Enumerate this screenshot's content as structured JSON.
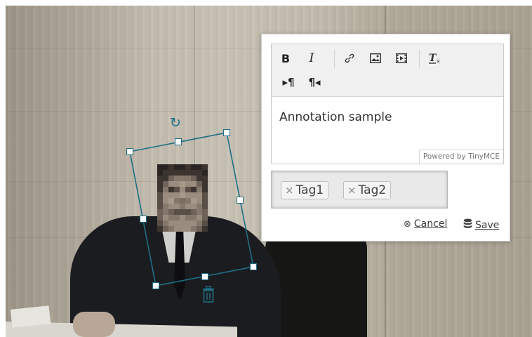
{
  "editor": {
    "toolbar": {
      "bold_label": "B",
      "italic_label": "I",
      "link_icon": "link-icon",
      "image_icon": "image-icon",
      "media_icon": "media-icon",
      "clear_format_icon": "clear-formatting-icon",
      "ltr_icon": "ltr-paragraph-icon",
      "rtl_icon": "rtl-paragraph-icon"
    },
    "content": "Annotation sample",
    "powered_by": "Powered by TinyMCE"
  },
  "tags": [
    {
      "label": "Tag1"
    },
    {
      "label": "Tag2"
    }
  ],
  "tag_remove_glyph": "×",
  "actions": {
    "cancel_label": "Cancel",
    "save_label": "Save"
  },
  "colors": {
    "selection": "#1f6f86",
    "popup_bg": "#ffffff",
    "toolbar_bg": "#f0f0f0"
  }
}
